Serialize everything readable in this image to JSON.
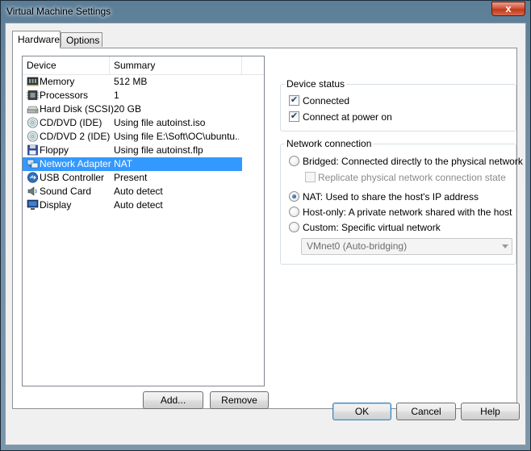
{
  "window": {
    "title": "Virtual Machine Settings",
    "close_glyph": "x"
  },
  "tabs": [
    {
      "label": "Hardware",
      "active": true
    },
    {
      "label": "Options",
      "active": false
    }
  ],
  "device_list": {
    "columns": [
      "Device",
      "Summary"
    ],
    "rows": [
      {
        "device": "Memory",
        "summary": "512 MB",
        "icon": "memory-icon"
      },
      {
        "device": "Processors",
        "summary": "1",
        "icon": "processor-icon"
      },
      {
        "device": "Hard Disk (SCSI)",
        "summary": "20 GB",
        "icon": "hard-disk-icon"
      },
      {
        "device": "CD/DVD (IDE)",
        "summary": "Using file autoinst.iso",
        "icon": "cd-dvd-icon"
      },
      {
        "device": "CD/DVD 2 (IDE)",
        "summary": "Using file E:\\Soft\\OC\\ubuntu...",
        "icon": "cd-dvd-icon"
      },
      {
        "device": "Floppy",
        "summary": "Using file autoinst.flp",
        "icon": "floppy-icon"
      },
      {
        "device": "Network Adapter",
        "summary": "NAT",
        "icon": "network-adapter-icon",
        "selected": true
      },
      {
        "device": "USB Controller",
        "summary": "Present",
        "icon": "usb-icon"
      },
      {
        "device": "Sound Card",
        "summary": "Auto detect",
        "icon": "sound-card-icon"
      },
      {
        "device": "Display",
        "summary": "Auto detect",
        "icon": "display-icon"
      }
    ]
  },
  "list_buttons": {
    "add": "Add...",
    "remove": "Remove"
  },
  "device_status": {
    "legend": "Device status",
    "connected": {
      "label": "Connected",
      "checked": true
    },
    "connect_at_power_on": {
      "label": "Connect at power on",
      "checked": true
    }
  },
  "network_connection": {
    "legend": "Network connection",
    "bridged": {
      "label": "Bridged: Connected directly to the physical network",
      "selected": false
    },
    "replicate": {
      "label": "Replicate physical network connection state",
      "checked": false,
      "disabled": true
    },
    "nat": {
      "label": "NAT: Used to share the host's IP address",
      "selected": true
    },
    "host_only": {
      "label": "Host-only: A private network shared with the host",
      "selected": false
    },
    "custom": {
      "label": "Custom: Specific virtual network",
      "selected": false
    },
    "custom_select": {
      "value": "VMnet0 (Auto-bridging)"
    }
  },
  "dialog_buttons": {
    "ok": "OK",
    "cancel": "Cancel",
    "help": "Help"
  },
  "colors": {
    "selection": "#3399ff",
    "title_bar": "#6f8da5",
    "close_button": "#c0391d"
  }
}
